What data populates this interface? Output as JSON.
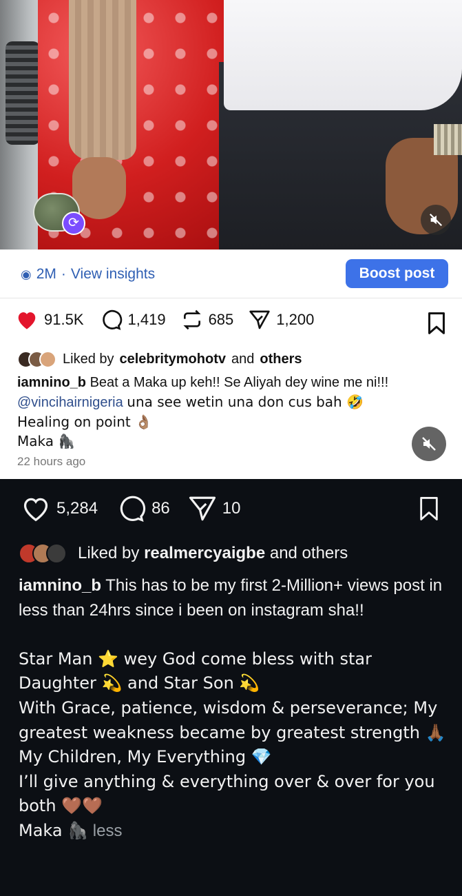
{
  "post_top": {
    "views": "2M",
    "view_insights_label": "View insights",
    "boost_label": "Boost post",
    "likes": "91.5K",
    "comments": "1,419",
    "reposts": "685",
    "shares": "1,200",
    "liked_by_prefix": "Liked by",
    "liked_by_user": "celebritymohotv",
    "liked_by_and": "and",
    "liked_by_others": "others",
    "caption_user": "iamnino_b",
    "caption_line1": "Beat a Maka up keh!! Se Aliyah dey wine me ni!!!",
    "caption_mention": "@vincihairnigeria",
    "caption_line2_rest": "una see wetin una don cus bah 🤣",
    "caption_line3": "Healing on point 👌🏽",
    "caption_line4": "Maka 🦍",
    "timestamp": "22 hours ago"
  },
  "post_bottom": {
    "likes": "5,284",
    "comments": "86",
    "shares": "10",
    "liked_by_prefix": "Liked by",
    "liked_by_user": "realmercyaigbe",
    "liked_by_suffix": "and others",
    "caption_user": "iamnino_b",
    "caption_first": "This has to be my first 2-Million+ views post in less than 24hrs since i been on instagram sha!!",
    "line_star_man": "Star Man ⭐ wey God come bless with star Daughter 💫 and Star Son 💫",
    "line_grace": "With Grace, patience, wisdom & perseverance; My greatest weakness became by greatest strength 🙏🏾",
    "line_children": "My Children, My Everything 💎",
    "line_give": "I’ll give anything & everything over & over for you both 🤎🤎",
    "line_maka": "Maka 🦍",
    "less_label": "less"
  },
  "icons": {
    "heart": "heart-icon",
    "comment": "comment-icon",
    "repost": "repost-icon",
    "share": "send-icon",
    "bookmark": "bookmark-icon",
    "mute": "muted-speaker-icon",
    "eye": "eye-icon",
    "remix": "remix-icon"
  },
  "colors": {
    "accent_blue": "#3d72e8",
    "heart_red": "#e3152c",
    "dark_bg": "#0c0f14"
  }
}
